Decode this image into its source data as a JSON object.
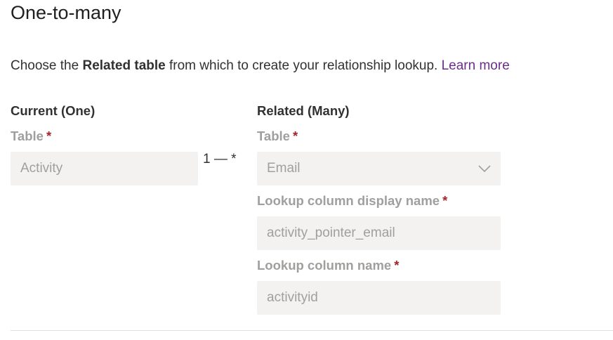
{
  "header": {
    "title": "One-to-many"
  },
  "description": {
    "prefix": "Choose the ",
    "bold": "Related table",
    "suffix": " from which to create your relationship lookup. ",
    "link": "Learn more"
  },
  "current": {
    "heading": "Current (One)",
    "table_label": "Table",
    "required_mark": "*",
    "table_value": "Activity"
  },
  "relation": {
    "one": "1",
    "dash": "—",
    "many": "*"
  },
  "related": {
    "heading": "Related (Many)",
    "table_label": "Table",
    "required_mark": "*",
    "table_value": "Email",
    "lookup_display_label": "Lookup column display name",
    "lookup_display_value": "activity_pointer_email",
    "lookup_name_label": "Lookup column name",
    "lookup_name_value": "activityid"
  },
  "icons": {
    "dropdown": "chevron-down-icon"
  },
  "colors": {
    "link": "#6b2e8a",
    "required": "#a4262c",
    "field_bg": "#f3f2f1"
  }
}
